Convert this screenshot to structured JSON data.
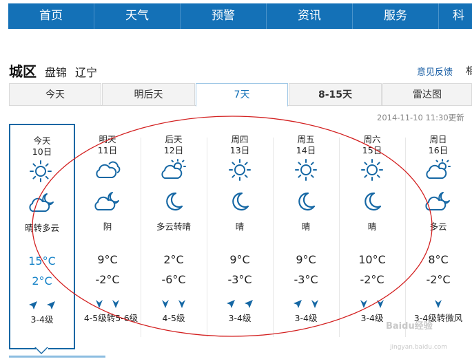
{
  "nav": {
    "items": [
      "首页",
      "天气",
      "预警",
      "资讯",
      "服务",
      "科"
    ]
  },
  "location": {
    "name": "城区",
    "city": "盘锦",
    "province": "辽宁"
  },
  "feedback_label": "意见反馈",
  "cut_char": "相",
  "tabs": [
    {
      "label": "今天"
    },
    {
      "label": "明后天"
    },
    {
      "label": "7天",
      "active": true
    },
    {
      "label": "8-15天"
    },
    {
      "label": "雷达图"
    }
  ],
  "updated": "2014-11-10 11:30更新",
  "colors": {
    "nav_bg": "#1471b7",
    "icon": "#1567a4",
    "selected_temp": "#1582c7",
    "annotation": "#d32020"
  },
  "days": [
    {
      "name": "今天",
      "date": "10日",
      "icon_day": "sun-icon",
      "icon_night": "partly-cloudy-night-icon",
      "desc": "晴转多云",
      "high": "15°C",
      "low": "2°C",
      "wind": [
        "northeast-arrow-icon",
        "northeast-arrow-icon"
      ],
      "level": "3-4级"
    },
    {
      "name": "明天",
      "date": "11日",
      "icon_day": "cloud-icon",
      "icon_night": "partly-cloudy-night-icon",
      "desc": "阴",
      "high": "9°C",
      "low": "-2°C",
      "wind": [
        "south-arrow-icon",
        "south-arrow-icon"
      ],
      "level": "4-5级转5-6级"
    },
    {
      "name": "后天",
      "date": "12日",
      "icon_day": "partly-cloudy-icon",
      "icon_night": "moon-icon",
      "desc": "多云转晴",
      "high": "2°C",
      "low": "-6°C",
      "wind": [
        "south-arrow-icon",
        "south-arrow-icon"
      ],
      "level": "4-5级"
    },
    {
      "name": "周四",
      "date": "13日",
      "icon_day": "sun-icon",
      "icon_night": "moon-icon",
      "desc": "晴",
      "high": "9°C",
      "low": "-3°C",
      "wind": [
        "northeast-arrow-icon",
        "northeast-arrow-icon"
      ],
      "level": "3-4级"
    },
    {
      "name": "周五",
      "date": "14日",
      "icon_day": "sun-icon",
      "icon_night": "moon-icon",
      "desc": "晴",
      "high": "9°C",
      "low": "-3°C",
      "wind": [
        "northeast-arrow-icon",
        "south-arrow-icon"
      ],
      "level": "3-4级"
    },
    {
      "name": "周六",
      "date": "15日",
      "icon_day": "sun-icon",
      "icon_night": "moon-icon",
      "desc": "晴",
      "high": "10°C",
      "low": "-2°C",
      "wind": [
        "south-arrow-icon",
        "south-arrow-icon"
      ],
      "level": "3-4级"
    },
    {
      "name": "周日",
      "date": "16日",
      "icon_day": "partly-cloudy-icon",
      "icon_night": "partly-cloudy-night-icon",
      "desc": "多云",
      "high": "8°C",
      "low": "-2°C",
      "wind": [
        "south-arrow-icon"
      ],
      "level": "3-4级转微风"
    }
  ],
  "watermark": {
    "text": "Baidu经验",
    "sub": "jingyan.baidu.com"
  }
}
